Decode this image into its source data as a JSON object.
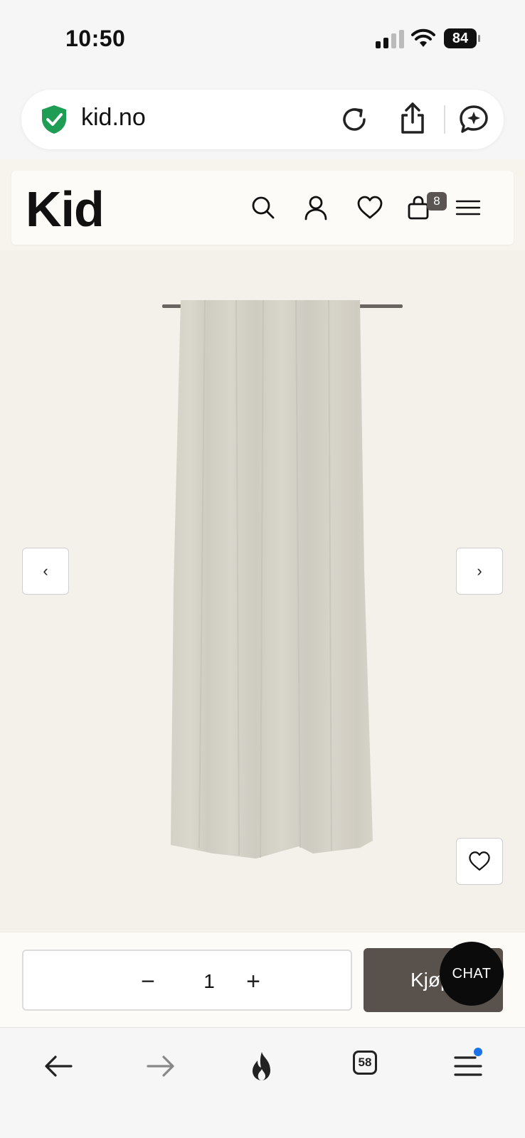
{
  "status_bar": {
    "time": "10:50",
    "battery": "84"
  },
  "browser": {
    "url": "kid.no",
    "tabs_count": "58"
  },
  "site": {
    "logo": "Kid",
    "cart_count": "8"
  },
  "product": {
    "image_icon": "curtain",
    "prev_icon": "‹",
    "next_icon": "›"
  },
  "purchase": {
    "quantity": "1",
    "minus_label": "−",
    "plus_label": "+",
    "buy_label": "Kjøp"
  },
  "chat": {
    "label": "CHAT"
  },
  "colors": {
    "accent": "#59514c",
    "page_bg": "#f7f4ee",
    "shield": "#1f9d55",
    "notification": "#1a73e8"
  }
}
